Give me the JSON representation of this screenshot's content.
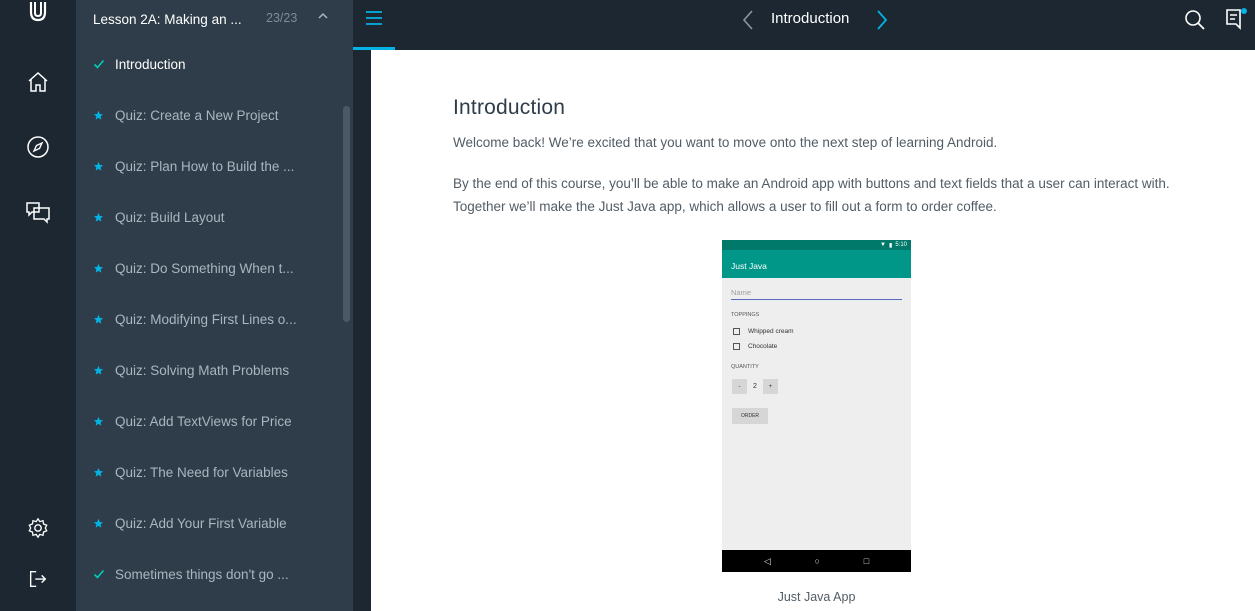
{
  "rail": {
    "icons": [
      "udacity-logo-icon",
      "home-icon",
      "compass-icon",
      "chat-icon",
      "settings-icon",
      "logout-icon"
    ]
  },
  "lesson_panel": {
    "title": "Lesson 2A: Making an ...",
    "count": "23/23",
    "items": [
      {
        "label": "Introduction",
        "status": "completed"
      },
      {
        "label": "Quiz: Create a New Project",
        "status": "starred"
      },
      {
        "label": "Quiz: Plan How to Build the ...",
        "status": "starred"
      },
      {
        "label": "Quiz: Build Layout",
        "status": "starred"
      },
      {
        "label": "Quiz: Do Something When t...",
        "status": "starred"
      },
      {
        "label": "Quiz: Modifying First Lines o...",
        "status": "starred"
      },
      {
        "label": "Quiz: Solving Math Problems",
        "status": "starred"
      },
      {
        "label": "Quiz: Add TextViews for Price",
        "status": "starred"
      },
      {
        "label": "Quiz: The Need for Variables",
        "status": "starred"
      },
      {
        "label": "Quiz: Add Your First Variable",
        "status": "starred"
      },
      {
        "label": "Sometimes things don't go ...",
        "status": "completed"
      }
    ]
  },
  "topbar": {
    "title": "Introduction"
  },
  "content": {
    "heading": "Introduction",
    "paragraph1": "Welcome back! We’re excited that you want to move onto the next step of learning Android.",
    "paragraph2": "By the end of this course, you’ll be able to make an Android app with buttons and text fields that a user can interact with. Together we’ll make the Just Java app, which allows a user to fill out a form to order coffee.",
    "image": {
      "status_time": "5:10",
      "app_title": "Just Java",
      "name_placeholder": "Name",
      "toppings_label": "TOPPINGS",
      "topping1": "Whipped cream",
      "topping2": "Chocolate",
      "quantity_label": "QUANTITY",
      "minus": "-",
      "quantity_value": "2",
      "plus": "+",
      "order_label": "ORDER"
    },
    "caption": "Just Java App"
  },
  "colors": {
    "rail_bg": "#1d2731",
    "panel_bg": "#2e3d49",
    "accent": "#02b3e4",
    "star": "#02b3e4",
    "check": "#02ccba"
  }
}
